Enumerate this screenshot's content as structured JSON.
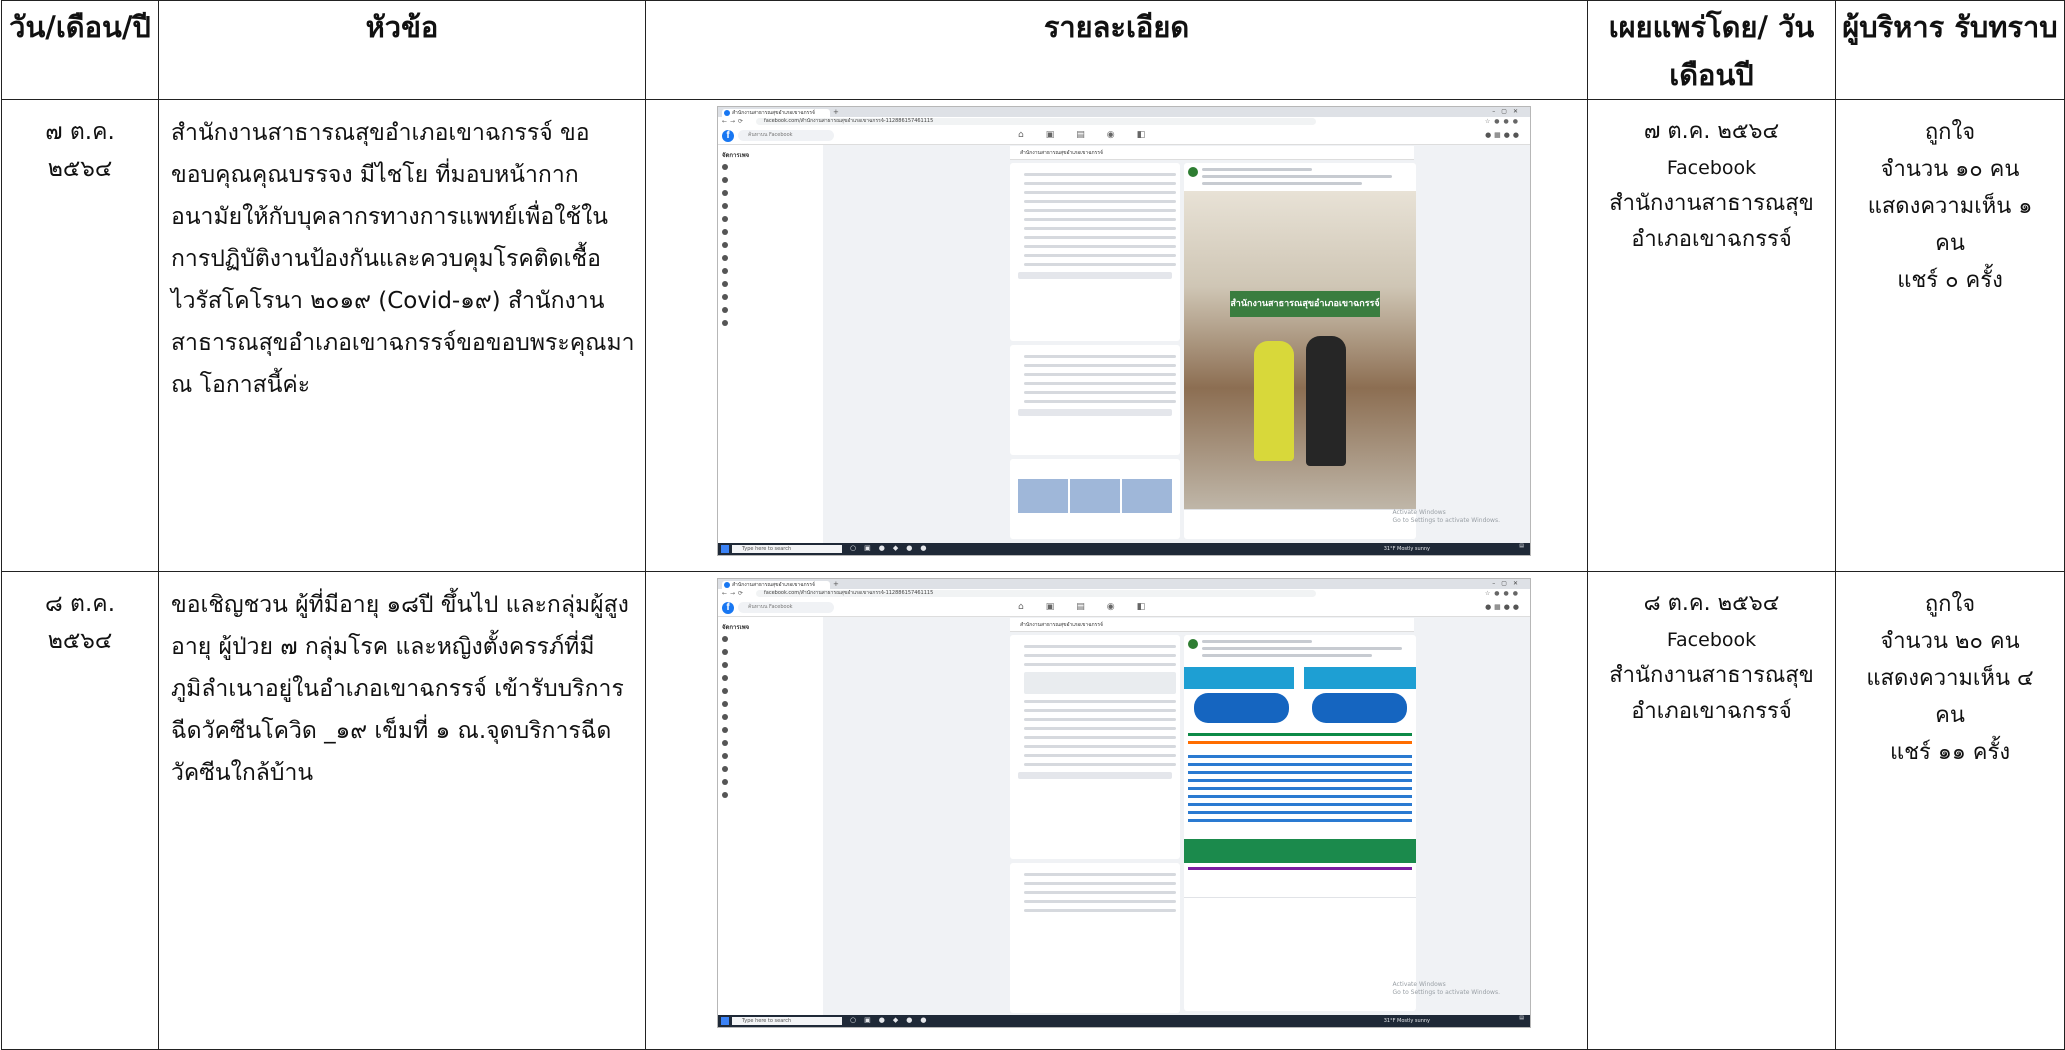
{
  "headers": {
    "date": "วัน/เดือน/ปี",
    "topic": "หัวข้อ",
    "detail": "รายละเอียด",
    "published": "เผยแพร่โดย/ วันเดือนปี",
    "acknowledged": "ผู้บริหาร รับทราบ"
  },
  "rows": [
    {
      "date_line1": "๗ ต.ค.",
      "date_line2": "๒๕๖๔",
      "topic": "สำนักงานสาธารณสุขอำเภอเขาฉกรรจ์ ขอขอบคุณคุณบรรจง มีไชโย ที่มอบหน้ากากอนามัยให้กับบุคลากรทางการแพทย์เพื่อใช้ในการปฏิบัติงานป้องกันและควบคุมโรคติดเชื้อไวรัสโคโรนา ๒๐๑๙ (Covid-๑๙) สำนักงานสาธารณสุขอำเภอเขาฉกรรจ์ขอขอบพระคุณมา ณ โอกาสนี้ค่ะ",
      "pub_date": "๗ ต.ค. ๒๕๖๔",
      "pub_channel": "Facebook",
      "pub_org_line1": "สำนักงานสาธารณสุข",
      "pub_org_line2": "อำเภอเขาฉกรรจ์",
      "ack_likes_label": "ถูกใจ",
      "ack_likes_count": "จำนวน ๑๐ คน",
      "ack_comments": "แสดงความเห็น ๑",
      "ack_comments_unit": "คน",
      "ack_shares": "แชร์ ๐ ครั้ง"
    },
    {
      "date_line1": "๘ ต.ค.",
      "date_line2": "๒๕๖๔",
      "topic": "ขอเชิญชวน ผู้ที่มีอายุ ๑๘ปี ขึ้นไป และกลุ่มผู้สูงอายุ ผู้ป่วย ๗ กลุ่มโรค และหญิงตั้งครรภ์ที่มีภูมิลำเนาอยู่ในอำเภอเขาฉกรรจ์ เข้ารับบริการฉีดวัคซีนโควิด _๑๙ เข็มที่ ๑ ณ.จุดบริการฉีดวัคซีนใกล้บ้าน",
      "pub_date": "๘ ต.ค. ๒๕๖๔",
      "pub_channel": "Facebook",
      "pub_org_line1": "สำนักงานสาธารณสุข",
      "pub_org_line2": "อำเภอเขาฉกรรจ์",
      "ack_likes_label": "ถูกใจ",
      "ack_likes_count": "จำนวน ๒๐ คน",
      "ack_comments": "แสดงความเห็น ๔",
      "ack_comments_unit": "คน",
      "ack_shares": "แชร์ ๑๑ ครั้ง"
    }
  ],
  "screenshot": {
    "tab_title": "สำนักงานสาธารณสุขอำเภอเขาฉกรรจ์",
    "search_placeholder": "ค้นหาบน Facebook",
    "url": "facebook.com/สำนักงานสาธารณสุขอำเภอเขาฉกรรจ์-112886157461115",
    "menu_title": "จัดการเพจ",
    "taskbar_search": "Type here to search",
    "weather": "31°F Mostly sunny",
    "activate_line1": "Activate Windows",
    "activate_line2": "Go to Settings to activate Windows.",
    "poster_sign": "สำนักงานสาธารณสุขอำเภอเขาฉกรรจ์",
    "brand_blue": "#1877f2"
  }
}
